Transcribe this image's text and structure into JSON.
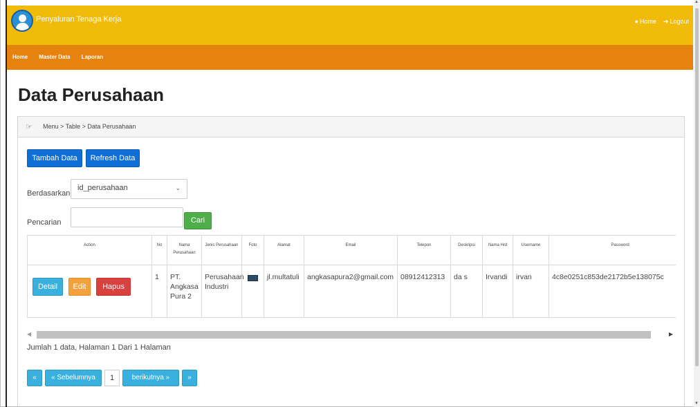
{
  "header": {
    "app_title": "Penyaluran Tenaga Kerja",
    "home_link": "Home",
    "logout_link": "Logout"
  },
  "nav": {
    "items": [
      {
        "label": "Home"
      },
      {
        "label": "Master Data"
      },
      {
        "label": "Laporan"
      }
    ]
  },
  "page": {
    "title": "Data Perusahaan",
    "breadcrumb": "Menu > Table > Data Perusahaan"
  },
  "toolbar": {
    "add_label": "Tambah Data",
    "refresh_label": "Refresh Data"
  },
  "filter": {
    "by_label": "Berdasarkan :",
    "by_value": "id_perusahaan",
    "search_label": "Pencarian",
    "search_value": "",
    "search_button": "Cari"
  },
  "table": {
    "headers": [
      "Action",
      "No",
      "Nama Perusahaan",
      "Jenis Perusahaan",
      "Foto",
      "Alamat",
      "Email",
      "Telepon",
      "Deskripsi",
      "Nama Hrd",
      "Username",
      "Password"
    ],
    "rows": [
      {
        "actions": {
          "detail": "Detail",
          "edit": "Edit",
          "delete": "Hapus"
        },
        "no": "1",
        "nama": "PT. Angkasa Pura 2",
        "jenis": "Perusahaan Industri",
        "alamat": "jl.multatuli",
        "email": "angkasapura2@gmail.com",
        "telepon": "08912412313",
        "deskripsi": "da s",
        "hrd": "Irvandi",
        "username": "irvan",
        "password": "4c8e0251c853de2172b5e138075c"
      }
    ]
  },
  "info": "Jumlah 1 data, Halaman 1 Dari 1 Halaman",
  "pager": {
    "first": "«",
    "prev": "« Sebelumnya",
    "current": "1",
    "next": "berikutnya »",
    "last": "»"
  },
  "colors": {
    "topbar": "#f0bb0a",
    "navbar": "#e6820e",
    "primary": "#0f6fd6",
    "success": "#4fae4a",
    "info": "#39b0dd",
    "warning": "#f3a13c",
    "danger": "#d9413f"
  }
}
